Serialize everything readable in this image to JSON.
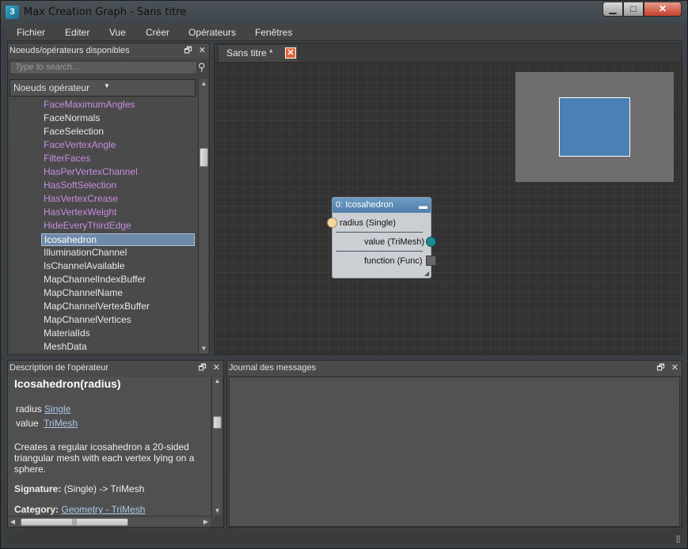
{
  "window": {
    "title": "Max Creation Graph - Sans titre",
    "app_icon": "3"
  },
  "menu": [
    "Fichier",
    "Editer",
    "Vue",
    "Créer",
    "Opérateurs",
    "Fenêtres"
  ],
  "nodes_panel": {
    "title": "Noeuds/opérateurs disponibles",
    "search_placeholder": "Type to search...",
    "list_header": "Noeuds opérateur",
    "items": [
      {
        "label": "FaceMaximumAngles",
        "color": "purple"
      },
      {
        "label": "FaceNormals",
        "color": "white"
      },
      {
        "label": "FaceSelection",
        "color": "white"
      },
      {
        "label": "FaceVertexAngle",
        "color": "purple"
      },
      {
        "label": "FilterFaces",
        "color": "purple"
      },
      {
        "label": "HasPerVertexChannel",
        "color": "purple"
      },
      {
        "label": "HasSoftSelection",
        "color": "purple"
      },
      {
        "label": "HasVertexCrease",
        "color": "purple"
      },
      {
        "label": "HasVertexWeight",
        "color": "purple"
      },
      {
        "label": "HideEveryThirdEdge",
        "color": "purple"
      },
      {
        "label": "Icosahedron",
        "color": "white",
        "selected": true
      },
      {
        "label": "IlluminationChannel",
        "color": "white"
      },
      {
        "label": "IsChannelAvailable",
        "color": "white"
      },
      {
        "label": "MapChannelIndexBuffer",
        "color": "white"
      },
      {
        "label": "MapChannelName",
        "color": "white"
      },
      {
        "label": "MapChannelVertexBuffer",
        "color": "white"
      },
      {
        "label": "MapChannelVertices",
        "color": "white"
      },
      {
        "label": "MaterialIds",
        "color": "white"
      },
      {
        "label": "MeshData",
        "color": "white"
      }
    ]
  },
  "graph": {
    "tab_label": "Sans titre *",
    "node": {
      "title": "0: Icosahedron",
      "input": "radius (Single)",
      "output_value": "value (TriMesh)",
      "output_function": "function (Func)"
    }
  },
  "description": {
    "panel_title": "Description de l'opérateur",
    "signature_title": "Icosahedron(radius)",
    "param1_name": "radius",
    "param1_type": "Single",
    "param2_name": "value",
    "param2_type": "TriMesh",
    "text_line1": "Creates a regular icosahedron a 20-sided",
    "text_line2": "triangular mesh with each vertex lying on a",
    "text_line3": "sphere.",
    "signature_label": "Signature:",
    "signature_value": "(Single) -> TriMesh",
    "category_label": "Category:",
    "category_value": "Geometry - TriMesh"
  },
  "log_panel": {
    "title": "Journal des messages"
  },
  "colors": {
    "purple_item": "#c78de0",
    "selection": "#6f8aa8",
    "node_header": "#5a8ab6",
    "port_in": "#f5d8a0",
    "port_out": "#1d8b95",
    "minimap_view": "#4a80b4"
  }
}
